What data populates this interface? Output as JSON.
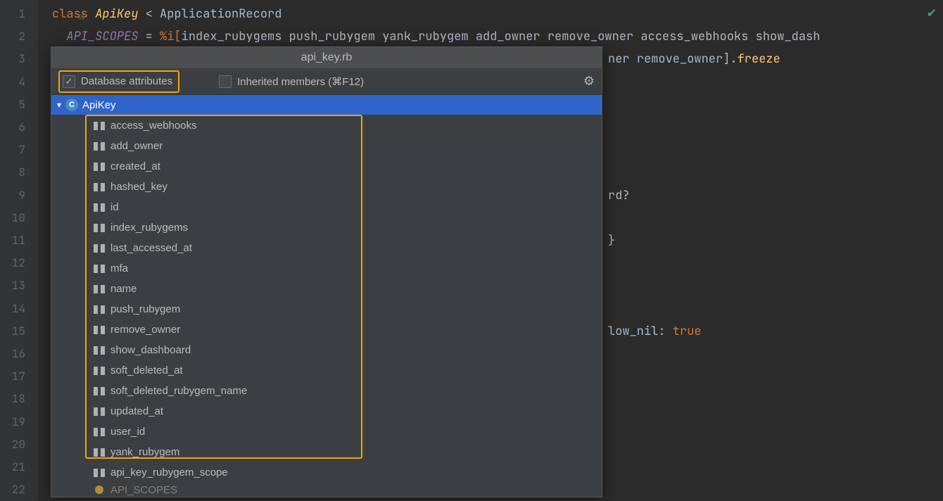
{
  "gutter": [
    "1",
    "2",
    "3",
    "4",
    "5",
    "6",
    "7",
    "8",
    "9",
    "10",
    "11",
    "12",
    "13",
    "14",
    "15",
    "16",
    "17",
    "18",
    "19",
    "20",
    "21",
    "22"
  ],
  "code": {
    "l1_class": "class ",
    "l1_name": "ApiKey",
    "l1_lt": " < ",
    "l1_super": "ApplicationRecord",
    "l2_const": "API_SCOPES",
    "l2_eq": " = ",
    "l2_pre": "%i[",
    "l2_list": "index_rubygems push_rubygem yank_rubygem add_owner remove_owner access_webhooks show_dash",
    "l3_tail": "ner remove_owner].",
    "l3_freeze": "freeze",
    "l9_tail": "rd?",
    "l11_brace": "}",
    "l15_mid": "low_nil: ",
    "l15_true": "true"
  },
  "popup": {
    "title": "api_key.rb",
    "dbAttrsLabel": "Database attributes",
    "inheritedLabel": "Inherited members (⌘F12)",
    "rootName": "ApiKey",
    "attrs": [
      "access_webhooks",
      "add_owner",
      "created_at",
      "hashed_key",
      "id",
      "index_rubygems",
      "last_accessed_at",
      "mfa",
      "name",
      "push_rubygem",
      "remove_owner",
      "show_dashboard",
      "soft_deleted_at",
      "soft_deleted_rubygem_name",
      "updated_at",
      "user_id",
      "yank_rubygem",
      "api_key_rubygem_scope"
    ],
    "truncated": "API_SCOPES"
  }
}
